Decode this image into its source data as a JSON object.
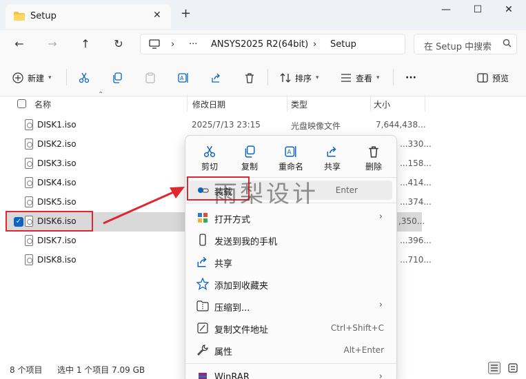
{
  "window": {
    "tab_title": "Setup",
    "tab_close": "✕",
    "new_tab": "+",
    "minimize": "—",
    "maximize": "☐",
    "close": "✕"
  },
  "nav": {
    "back": "←",
    "forward": "→",
    "up": "↑",
    "refresh": "↻",
    "breadcrumb": [
      "ANSYS2025 R2(64bit)",
      "Setup"
    ],
    "overflow": "···",
    "chevron": "›",
    "search_placeholder": "在 Setup 中搜索"
  },
  "toolbar": {
    "new_label": "新建",
    "sort_label": "排序",
    "view_label": "查看",
    "more_label": "···",
    "preview_label": "预览"
  },
  "columns": {
    "name": "名称",
    "date": "修改日期",
    "type": "类型",
    "size": "大小"
  },
  "files": [
    {
      "name": "DISK1.iso",
      "date": "2025/7/13 23:15",
      "type": "光盘映像文件",
      "size": "7,644,438..."
    },
    {
      "name": "DISK2.iso",
      "size": "...330..."
    },
    {
      "name": "DISK3.iso",
      "size": "...158..."
    },
    {
      "name": "DISK4.iso",
      "size": "...414..."
    },
    {
      "name": "DISK5.iso",
      "size": "...374..."
    },
    {
      "name": "DISK6.iso",
      "size": ",350...",
      "selected": true
    },
    {
      "name": "DISK7.iso",
      "size": "...396..."
    },
    {
      "name": "DISK8.iso",
      "size": "...710..."
    }
  ],
  "status": {
    "count": "8 个项目",
    "selection": "选中 1 个项目  7.09 GB"
  },
  "context_menu": {
    "quick_actions": [
      "剪切",
      "复制",
      "重命名",
      "共享",
      "删除"
    ],
    "items": [
      {
        "label": "装载",
        "shortcut": "Enter",
        "highlighted": true
      },
      {
        "label": "打开方式",
        "submenu": true
      },
      {
        "label": "发送到我的手机"
      },
      {
        "label": "共享"
      },
      {
        "label": "添加到收藏夹"
      },
      {
        "label": "压缩到...",
        "submenu": true
      },
      {
        "label": "复制文件地址",
        "shortcut": "Ctrl+Shift+C"
      },
      {
        "label": "属性",
        "shortcut": "Alt+Enter"
      },
      {
        "label": "WinRAR",
        "submenu": true
      }
    ]
  },
  "watermark": "雨梨设计",
  "colors": {
    "accent": "#0a64c2",
    "annotation": "#e0262f"
  }
}
